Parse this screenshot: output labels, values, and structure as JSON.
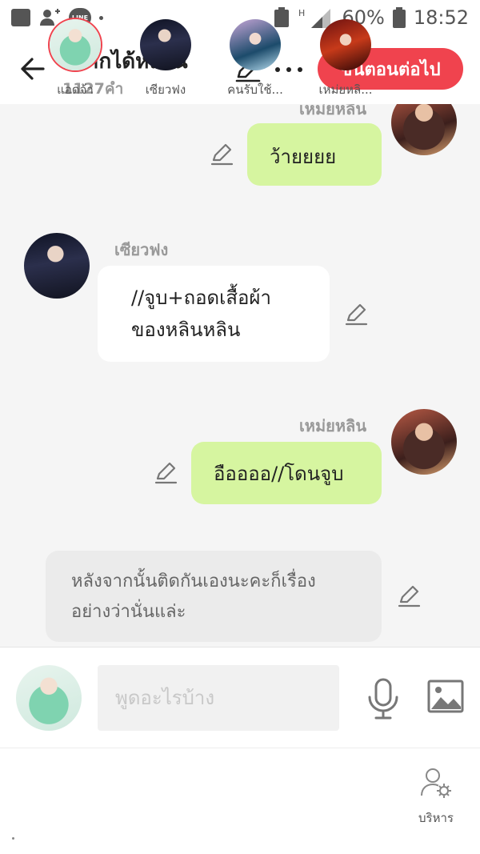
{
  "status_bar": {
    "battery": "60%",
    "time": "18:52",
    "icons": [
      "gallery-icon",
      "add-contact-icon",
      "line-app-icon",
      "notification-dot-icon",
      "recycle-icon",
      "signal-icon",
      "battery-icon"
    ]
  },
  "header": {
    "title": "อยากได้หลาน",
    "word_count": "1127คำ",
    "next_button": "ขั้นตอนต่อไป",
    "icons": [
      "back-arrow-icon",
      "edit-icon",
      "more-icon"
    ]
  },
  "messages": [
    {
      "sender": "เหม่ยหลิน",
      "text": "ว้ายยยย",
      "side": "right"
    },
    {
      "sender": "เซียวฟง",
      "text_lines": [
        "//จูบ+ถอดเสื้อผ้า",
        "ของหลินหลิน"
      ],
      "side": "left"
    },
    {
      "sender": "เหม่ยหลิน",
      "text": "อืออออ//โดนจูบ",
      "side": "right"
    },
    {
      "type": "narration",
      "text_lines": [
        "หลังจากนั้นติดกันเองนะคะก็เรื่อง",
        "อย่างว่านั่นแล่ะ"
      ]
    }
  ],
  "input": {
    "placeholder": "พูดอะไรบ้าง"
  },
  "characters": [
    {
      "label": "แอดจ้า",
      "selected": true
    },
    {
      "label": "เซียวฟง",
      "selected": false
    },
    {
      "label": "คนรับใช้...",
      "selected": false
    },
    {
      "label": "เหม่ยหลิ...",
      "selected": false
    }
  ],
  "manage_label": "บริหาร",
  "colors": {
    "accent": "#f0434e",
    "my_bubble": "#d6f5a0",
    "other_bubble": "#ffffff",
    "narration_bubble": "#ebebeb"
  }
}
